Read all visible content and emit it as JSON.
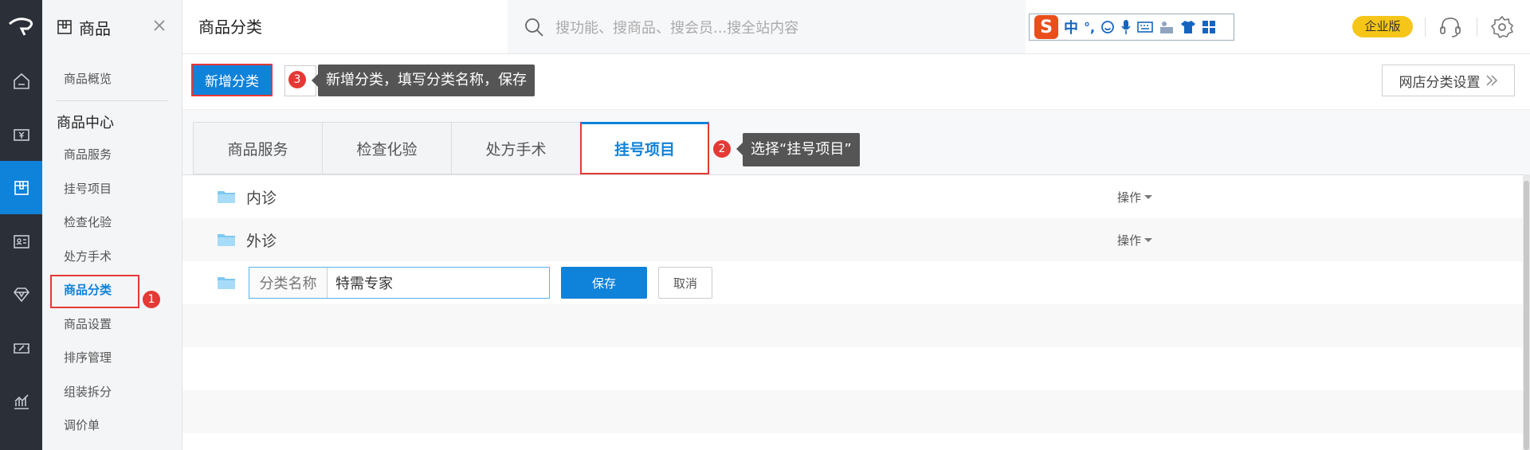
{
  "sidebar": {
    "title": "商品",
    "overview": "商品概览",
    "group_title": "商品中心",
    "items": [
      "商品服务",
      "挂号项目",
      "检查化验",
      "处方手术",
      "商品分类",
      "商品设置",
      "排序管理",
      "组装拆分",
      "调价单"
    ],
    "active_index": 4
  },
  "topbar": {
    "page_title": "商品分类",
    "search_placeholder": "搜功能、搜商品、搜会员...搜全站内容",
    "ime_zh": "中",
    "ime_punct": "°,",
    "edition_badge": "企业版"
  },
  "toolbar": {
    "new_category_label": "新增分类",
    "shop_category_settings_label": "网店分类设置"
  },
  "tips": {
    "step3": {
      "num": "3",
      "text": "新增分类，填写分类名称，保存"
    },
    "step2": {
      "num": "2",
      "text": "选择“挂号项目”"
    },
    "step1": {
      "num": "1"
    }
  },
  "tabs": [
    "商品服务",
    "检查化验",
    "处方手术",
    "挂号项目"
  ],
  "active_tab_index": 3,
  "categories": [
    {
      "name": "内诊",
      "op_label": "操作"
    },
    {
      "name": "外诊",
      "op_label": "操作"
    }
  ],
  "new_category_row": {
    "field_label": "分类名称",
    "field_value": "特需专家",
    "save_label": "保存",
    "cancel_label": "取消"
  },
  "colors": {
    "accent": "#0f82d9",
    "highlight_red": "#e53935",
    "rail_bg": "#2b2f38",
    "badge_yellow": "#f5c518"
  }
}
